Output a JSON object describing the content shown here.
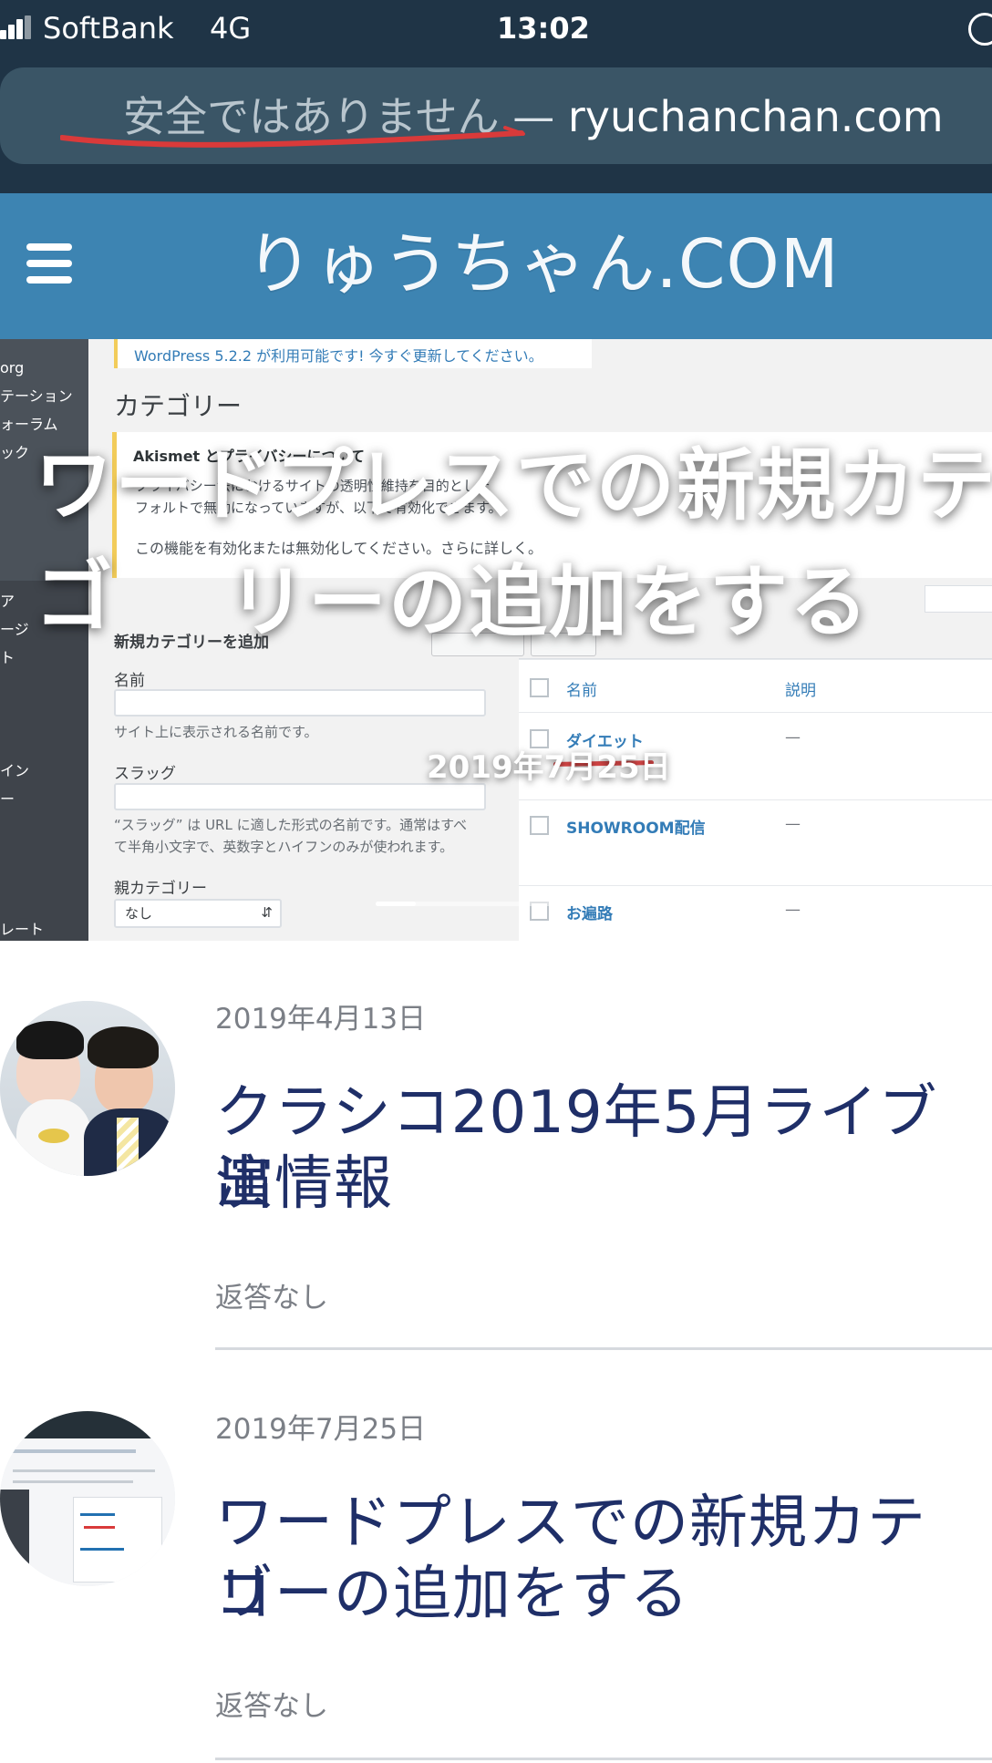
{
  "status_bar": {
    "carrier": "SoftBank",
    "network": "4G",
    "time": "13:02"
  },
  "browser": {
    "warning_text": "安全ではありません",
    "separator": "—",
    "domain": "ryuchanchan.com"
  },
  "site": {
    "title": "りゅうちゃん.COM",
    "menu_icon": "hamburger-icon"
  },
  "hero": {
    "title_line_1": "ワードプレスでの新規カテゴ",
    "title_line_2": "リーの追加をする",
    "date": "2019年7月25日",
    "background": {
      "update_text": "WordPress 5.2.2 が利用可能です! 今すぐ更新してください。",
      "heading": "カテゴリー",
      "notice_heading": "Akismet とプライバシーについて",
      "notice_text_1": "プライバシー法におけるサイトの透明性維持を目的とした",
      "notice_text_2": "フォルトで無効になっていますが、以下で有効化できます。",
      "notice_text_3": "この機能を有効化または無効化してください。さらに詳しく。",
      "add_category_heading": "新規カテゴリーを追加",
      "name_label": "名前",
      "name_help": "サイト上に表示される名前です。",
      "slug_label": "スラッグ",
      "slug_help_1": "“スラッグ” は URL に適した形式の名前です。通常はすべ",
      "slug_help_2": "て半角小文字で、英数字とハイフンのみが使われます。",
      "parent_label": "親カテゴリー",
      "parent_value": "なし",
      "column_name": "名前",
      "column_description": "説明",
      "row_1": "ダイエット",
      "row_2": "SHOWROOM配信",
      "row_3": "お遍路",
      "dash": "—",
      "sidebar_items": [
        "org",
        "テーション",
        "ォーラム",
        "ック",
        "ア",
        "ージ",
        "ト",
        "イン",
        "ー",
        "レート"
      ]
    }
  },
  "posts": [
    {
      "date": "2019年4月13日",
      "title_line_1": "クラシコ2019年5月ライブ出",
      "title_line_2": "演情報",
      "replies": "返答なし"
    },
    {
      "date": "2019年7月25日",
      "title_line_1": "ワードプレスでの新規カテゴ",
      "title_line_2": "リーの追加をする",
      "replies": "返答なし"
    }
  ],
  "colors": {
    "status_bg": "#1f3446",
    "address_bg": "#3a5566",
    "header_bg": "#3d84b2",
    "post_title": "#1f2f68",
    "muted_text": "#7b7f86",
    "red_annotation": "#d93a3a"
  }
}
